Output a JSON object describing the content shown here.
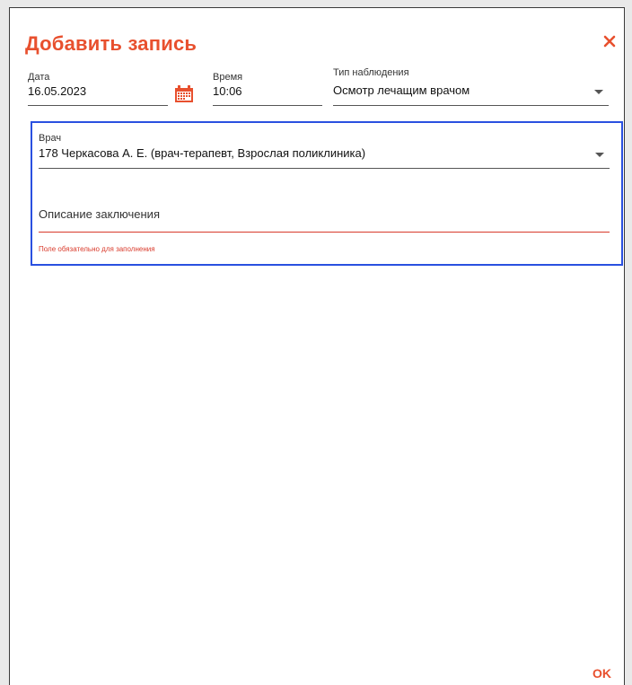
{
  "dialog": {
    "title": "Добавить запись",
    "ok_label": "OK",
    "accent": "#e8502e",
    "error_color": "#d93a2b",
    "focus_color": "#2a50e0"
  },
  "fields": {
    "date": {
      "label": "Дата",
      "value": "16.05.2023"
    },
    "time": {
      "label": "Время",
      "value": "10:06"
    },
    "type": {
      "label": "Тип наблюдения",
      "value": "Осмотр лечащим врачом"
    },
    "doctor": {
      "label": "Врач",
      "value": "178 Черкасова А. Е. (врач-терапевт, Взрослая поликлиника)"
    },
    "conclusion": {
      "placeholder": "Описание заключения",
      "error": "Поле обязательно для заполнения"
    }
  },
  "icons": {
    "close": "close-icon",
    "calendar": "calendar-icon",
    "dropdown": "chevron-down-icon"
  }
}
